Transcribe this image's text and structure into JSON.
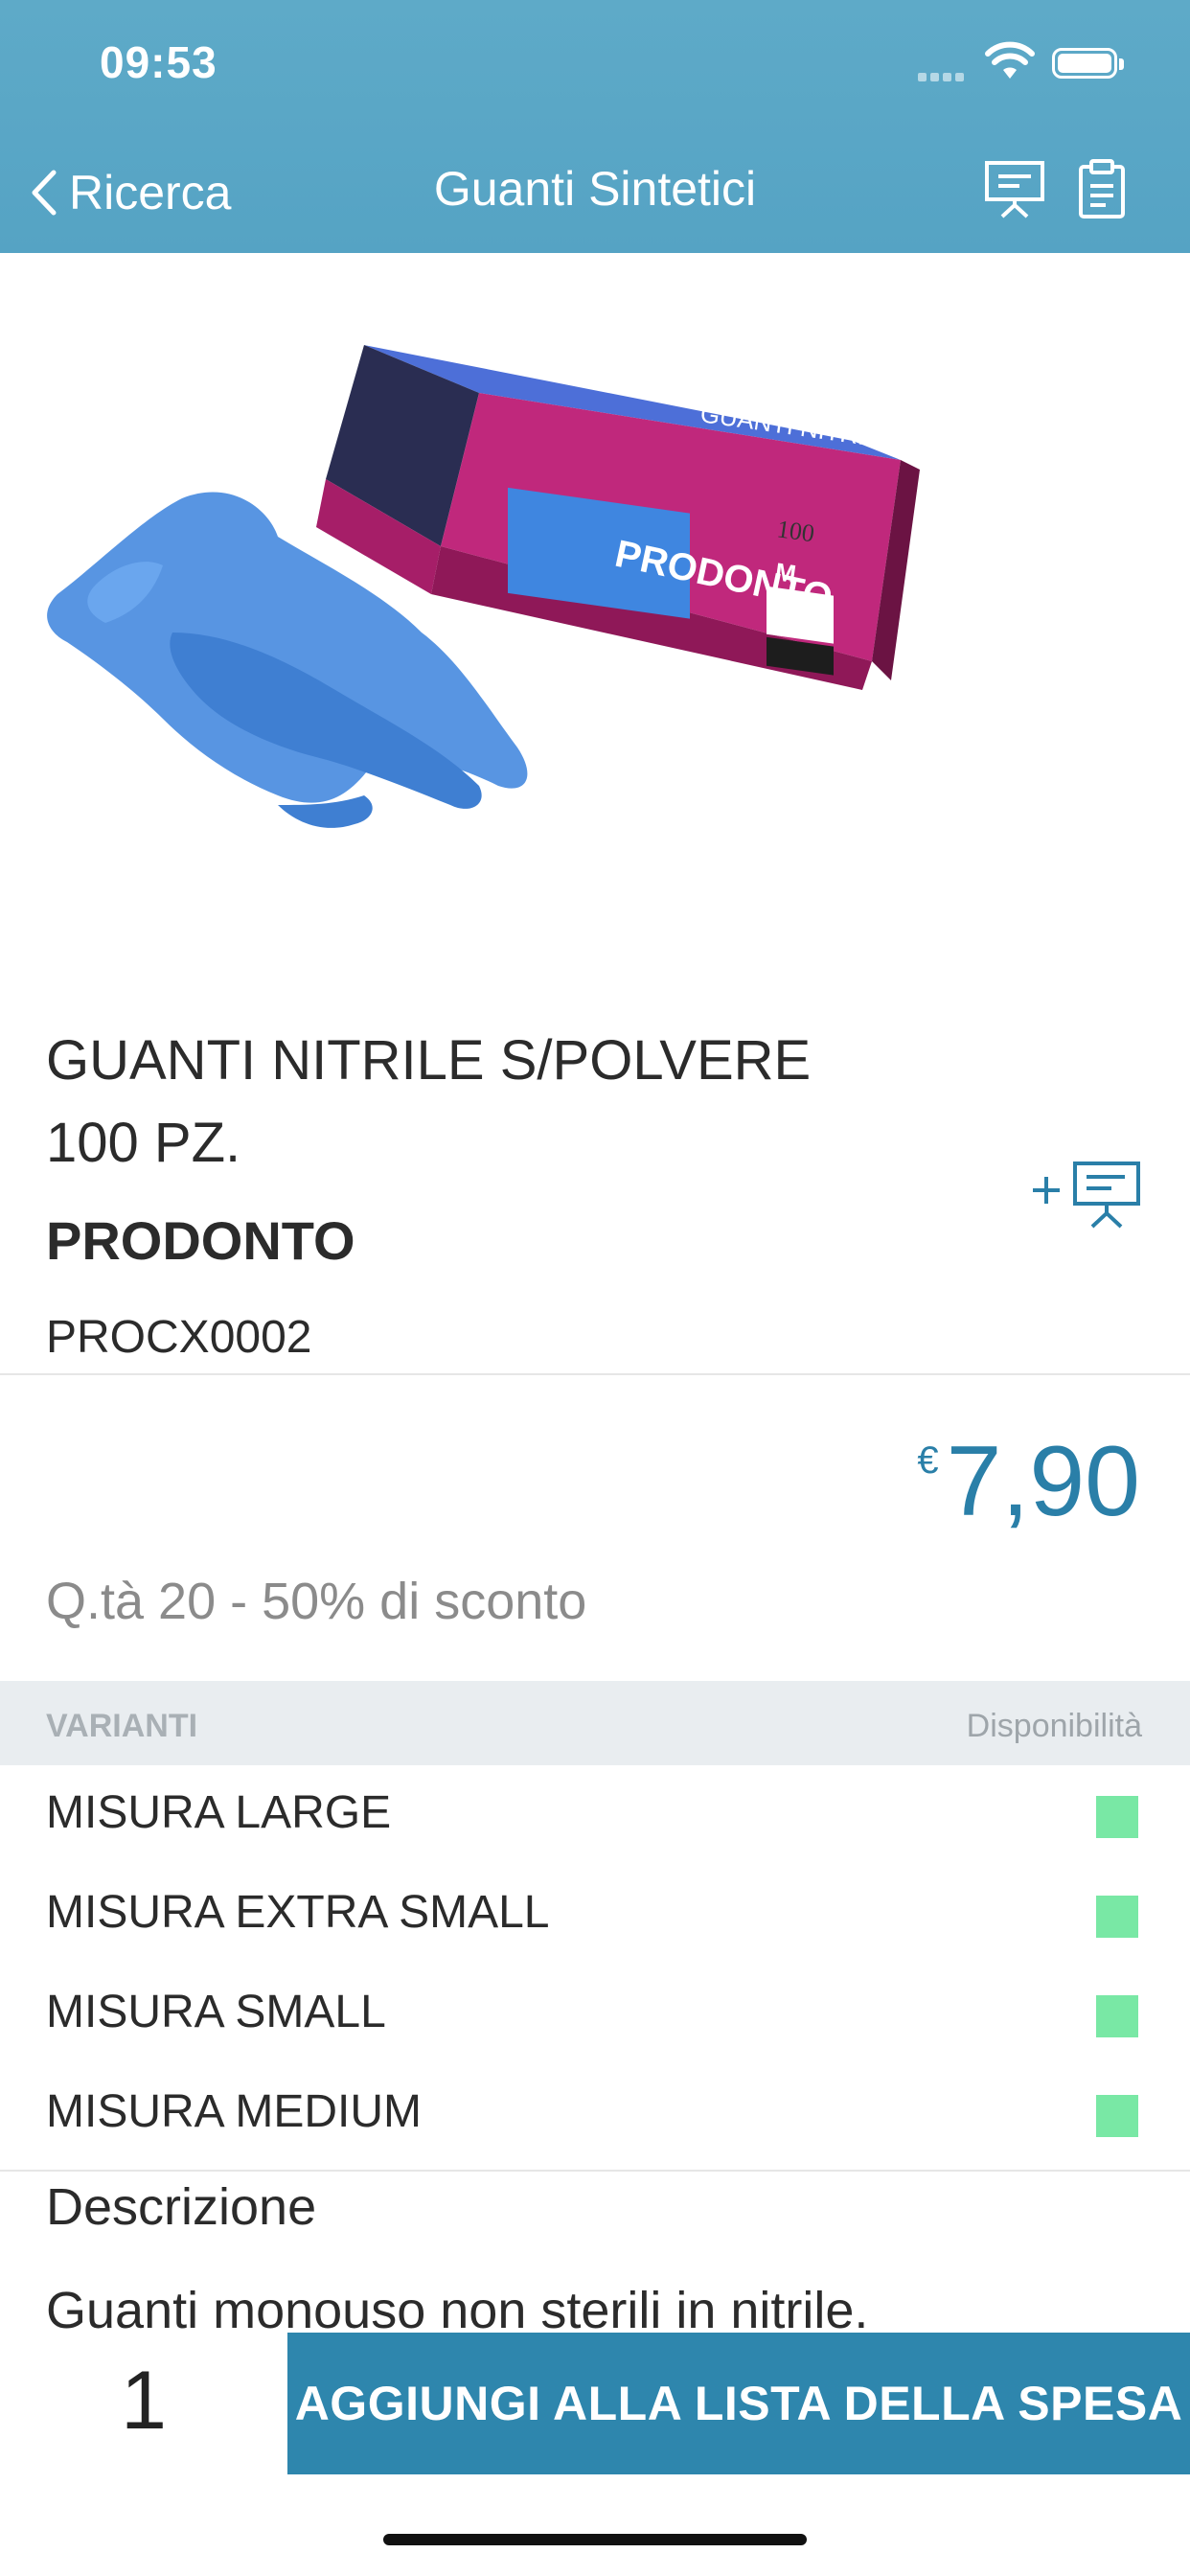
{
  "status_bar": {
    "time": "09:53"
  },
  "nav": {
    "back_label": "Ricerca",
    "title": "Guanti Sintetici"
  },
  "product": {
    "name": "GUANTI NITRILE S/POLVERE 100 PZ.",
    "brand": "PRODONTO",
    "code": "PROCX0002",
    "image_text": {
      "box_top": "GUANTI NITRILE",
      "box_brand": "PRODONTO",
      "box_size": "M",
      "box_count": "100"
    }
  },
  "price": {
    "currency": "€",
    "value": "7,90",
    "discount_text": "Q.tà 20 - 50% di sconto",
    "color": "#2a7fa8"
  },
  "variants": {
    "header_left": "VARIANTI",
    "header_right": "Disponibilità",
    "items": [
      {
        "label": "MISURA LARGE",
        "available": true
      },
      {
        "label": "MISURA EXTRA SMALL",
        "available": true
      },
      {
        "label": "MISURA SMALL",
        "available": true
      },
      {
        "label": "MISURA MEDIUM",
        "available": true
      }
    ],
    "availability_color": "#79e8a5"
  },
  "description": {
    "title": "Descrizione",
    "text": "Guanti monouso non sterili in nitrile."
  },
  "cart": {
    "quantity": "1",
    "add_button_label": "AGGIUNGI ALLA LISTA DELLA SPESA"
  },
  "colors": {
    "header": "#5aa7c6",
    "button": "#2e86ad"
  }
}
